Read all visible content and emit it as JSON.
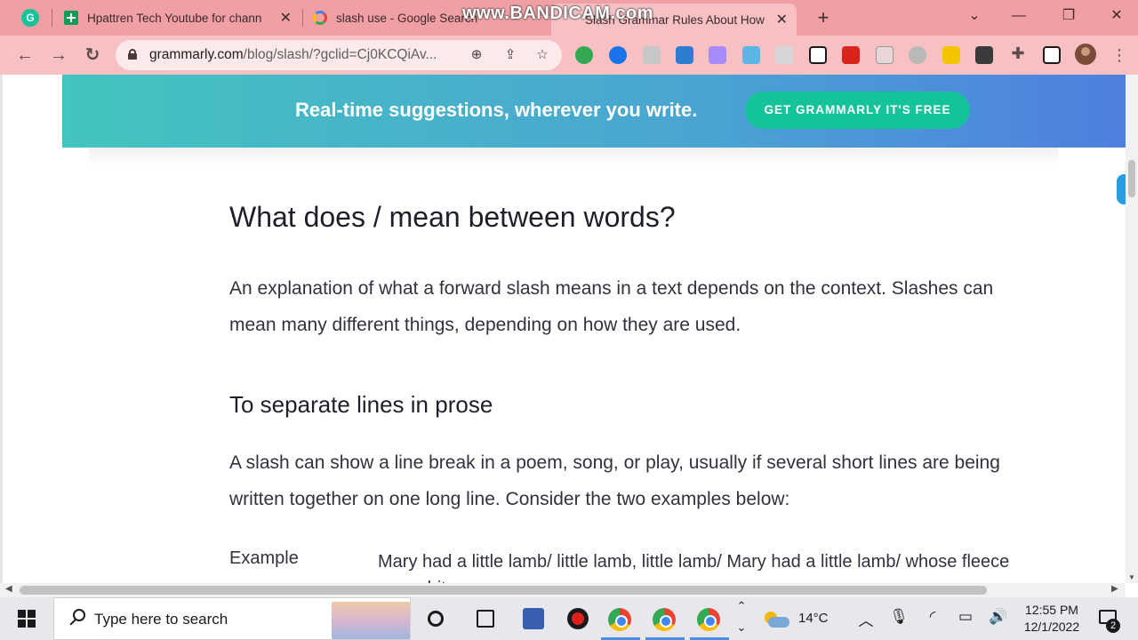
{
  "browser": {
    "tabs": [
      {
        "title": "Hpattren Tech Youtube for chann",
        "active": false
      },
      {
        "title": "slash use - Google Search",
        "active": false
      },
      {
        "title": "Slash Grammar Rules About How",
        "active": true
      }
    ],
    "url_host": "grammarly.com",
    "url_path": "/blog/slash/?gclid=Cj0KCQiAv...",
    "watermark": "www.BANDICAM.com"
  },
  "banner": {
    "tagline": "Real-time suggestions, wherever you write.",
    "cta": "GET GRAMMARLY IT'S FREE"
  },
  "article": {
    "heading": "What does / mean between words?",
    "intro": "An explanation of what a forward slash means in a text depends on the context. Slashes can mean many different things, depending on how they are used.",
    "subheading": "To separate lines in prose",
    "body": "A slash can show a line break in a poem, song, or play, usually if several short lines are being written together on one long line. Consider the two examples below:",
    "example_label": "Example",
    "example_text": "Mary had a little lamb/ little lamb, little lamb/ Mary had a little lamb/ whose fleece was white"
  },
  "taskbar": {
    "search_placeholder": "Type here to search",
    "weather": "14°C",
    "time": "12:55 PM",
    "date": "12/1/2022",
    "notifications": "2"
  },
  "colors": {
    "tab_bar": "#f0a0a4",
    "banner_start": "#43c4bf",
    "banner_end": "#4f7fe0",
    "cta": "#15c39a"
  }
}
